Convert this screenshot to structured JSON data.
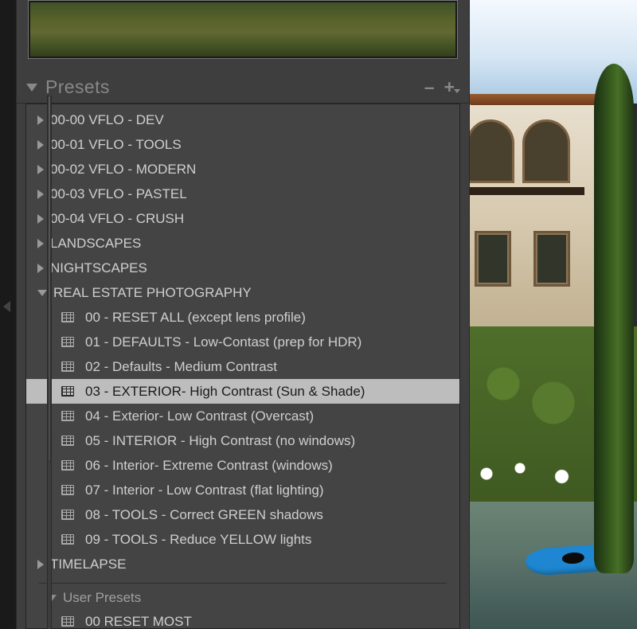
{
  "panel": {
    "title": "Presets",
    "minus": "–",
    "plus": "+"
  },
  "folders": [
    {
      "label": "00-00 VFLO - DEV",
      "expanded": false
    },
    {
      "label": "00-01 VFLO - TOOLS",
      "expanded": false
    },
    {
      "label": "00-02 VFLO - MODERN",
      "expanded": false
    },
    {
      "label": "00-03 VFLO - PASTEL",
      "expanded": false
    },
    {
      "label": "00-04 VFLO - CRUSH",
      "expanded": false
    },
    {
      "label": "LANDSCAPES",
      "expanded": false
    },
    {
      "label": "NIGHTSCAPES",
      "expanded": false
    },
    {
      "label": "REAL ESTATE PHOTOGRAPHY",
      "expanded": true
    }
  ],
  "presets": [
    {
      "label": "00 - RESET ALL (except lens profile)",
      "selected": false
    },
    {
      "label": "01 - DEFAULTS - Low-Contast  (prep for HDR)",
      "selected": false
    },
    {
      "label": "02 - Defaults - Medium Contrast",
      "selected": false
    },
    {
      "label": "03 - EXTERIOR- High Contrast (Sun & Shade)",
      "selected": true
    },
    {
      "label": "04 - Exterior- Low Contrast (Overcast)",
      "selected": false
    },
    {
      "label": "05 - INTERIOR - High Contrast (no windows)",
      "selected": false
    },
    {
      "label": "06 - Interior- Extreme Contrast (windows)",
      "selected": false
    },
    {
      "label": "07 - Interior - Low Contrast (flat lighting)",
      "selected": false
    },
    {
      "label": "08 - TOOLS - Correct GREEN shadows",
      "selected": false
    },
    {
      "label": "09 - TOOLS - Reduce YELLOW lights",
      "selected": false
    }
  ],
  "after_folder": {
    "label": "TIMELAPSE",
    "expanded": false
  },
  "user_section": {
    "label": "User Presets"
  },
  "user_presets": [
    {
      "label": "00     RESET MOST"
    }
  ]
}
